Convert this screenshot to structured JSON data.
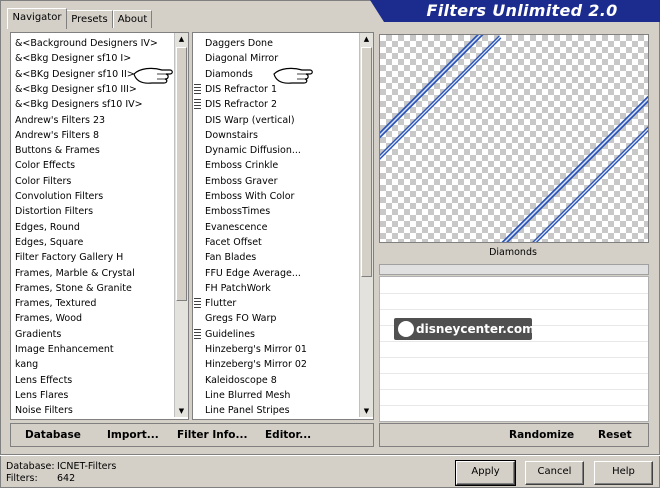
{
  "tabs": [
    {
      "label": "Navigator"
    },
    {
      "label": "Presets"
    },
    {
      "label": "About"
    }
  ],
  "banner": {
    "title": "Filters Unlimited 2.0"
  },
  "categories": [
    "&<Background Designers IV>",
    "&<Bkg Designer sf10 I>",
    "&<BKg Designer sf10 II>",
    "&<Bkg Designer sf10 III>",
    "&<Bkg Designers sf10 IV>",
    "Andrew's Filters 23",
    "Andrew's Filters 8",
    "Buttons & Frames",
    "Color Effects",
    "Color Filters",
    "Convolution Filters",
    "Distortion Filters",
    "Edges, Round",
    "Edges, Square",
    "Filter Factory Gallery H",
    "Frames, Marble & Crystal",
    "Frames, Stone & Granite",
    "Frames, Textured",
    "Frames, Wood",
    "Gradients",
    "Image Enhancement",
    "kang",
    "Lens Effects",
    "Lens Flares",
    "Noise Filters"
  ],
  "filters": [
    {
      "label": "Daggers Done",
      "grip": false
    },
    {
      "label": "Diagonal Mirror",
      "grip": false
    },
    {
      "label": "Diamonds",
      "grip": false
    },
    {
      "label": "DIS Refractor 1",
      "grip": true
    },
    {
      "label": "DIS Refractor 2",
      "grip": true
    },
    {
      "label": "DIS Warp (vertical)",
      "grip": false
    },
    {
      "label": "Downstairs",
      "grip": false
    },
    {
      "label": "Dynamic Diffusion...",
      "grip": false
    },
    {
      "label": "Emboss Crinkle",
      "grip": false
    },
    {
      "label": "Emboss Graver",
      "grip": false
    },
    {
      "label": "Emboss With Color",
      "grip": false
    },
    {
      "label": "EmbossTimes",
      "grip": false
    },
    {
      "label": "Evanescence",
      "grip": false
    },
    {
      "label": "Facet Offset",
      "grip": false
    },
    {
      "label": "Fan Blades",
      "grip": false
    },
    {
      "label": "FFU Edge Average...",
      "grip": false
    },
    {
      "label": "FH PatchWork",
      "grip": false
    },
    {
      "label": "Flutter",
      "grip": true
    },
    {
      "label": "Gregs FO Warp",
      "grip": false
    },
    {
      "label": "Guidelines",
      "grip": true
    },
    {
      "label": "Hinzeberg's Mirror 01",
      "grip": false
    },
    {
      "label": "Hinzeberg's Mirror 02",
      "grip": false
    },
    {
      "label": "Kaleidoscope 8",
      "grip": false
    },
    {
      "label": "Line Blurred Mesh",
      "grip": false
    },
    {
      "label": "Line Panel Stripes",
      "grip": false
    }
  ],
  "preview": {
    "filter_name": "Diamonds"
  },
  "toolbar": {
    "database": "Database",
    "import": "Import...",
    "filter_info": "Filter Info...",
    "editor": "Editor...",
    "randomize": "Randomize",
    "reset": "Reset"
  },
  "status": {
    "database_label": "Database:",
    "database_value": "ICNET-Filters",
    "filters_label": "Filters:",
    "filters_value": "642"
  },
  "buttons": {
    "apply": "Apply",
    "cancel": "Cancel",
    "help": "Help"
  },
  "watermark": {
    "text": "disneycenter.com"
  },
  "colors": {
    "banner": "#1c2c8e",
    "stripe": "#2e56b4"
  }
}
